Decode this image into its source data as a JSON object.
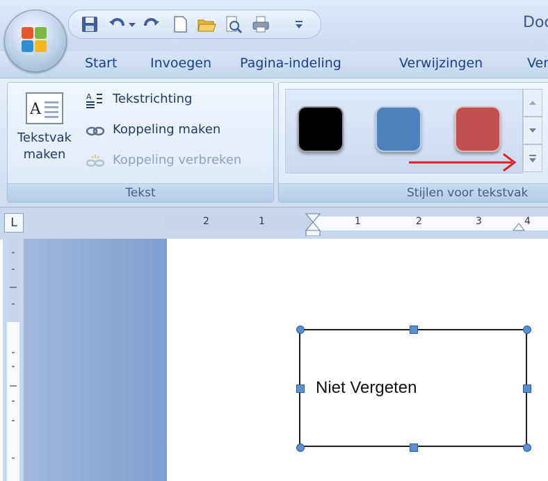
{
  "window": {
    "title_partial": "Doc"
  },
  "tabs": [
    "Start",
    "Invoegen",
    "Pagina-indeling",
    "Verwijzingen",
    "Ver"
  ],
  "ribbon": {
    "tekst_group": {
      "label": "Tekst",
      "textbox_button_line1": "Tekstvak",
      "textbox_button_line2": "maken",
      "text_direction": "Tekstrichting",
      "link_create": "Koppeling maken",
      "link_break": "Koppeling verbreken"
    },
    "styles_group": {
      "label": "Stijlen voor tekstvak",
      "swatches": [
        {
          "name": "black",
          "color": "#000000"
        },
        {
          "name": "blue",
          "color": "#4f81bd"
        },
        {
          "name": "red",
          "color": "#c0504d"
        }
      ],
      "arrow_color": "#e02020"
    }
  },
  "ruler": {
    "corner_glyph": "L",
    "ticks": [
      "2",
      "1",
      "1",
      "2",
      "3",
      "4"
    ]
  },
  "document": {
    "textbox_text": "Niet Vergeten"
  }
}
